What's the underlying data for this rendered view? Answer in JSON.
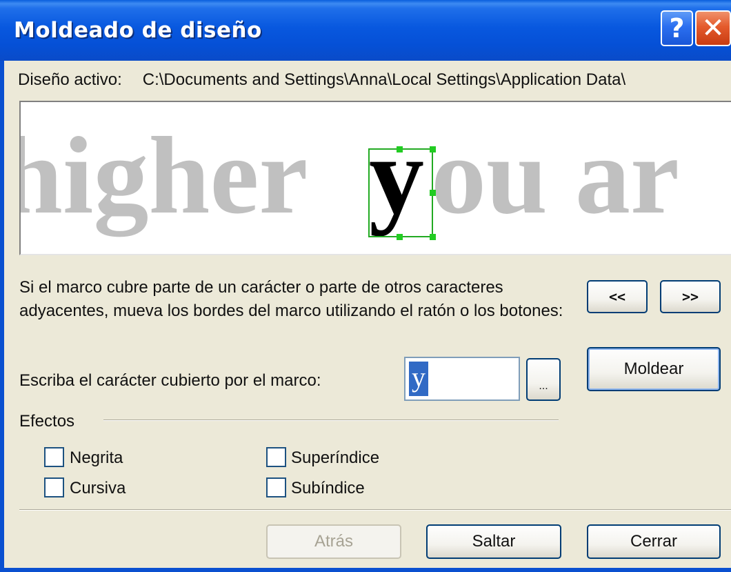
{
  "window": {
    "title": "Moldeado de diseño",
    "help_label": "?",
    "close_label": "✕"
  },
  "active_pattern": {
    "label": "Diseño activo:",
    "path": "C:\\Documents and Settings\\Anna\\Local Settings\\Application Data\\"
  },
  "preview": {
    "text": "higher you ar",
    "highlighted_char": "y",
    "frame_color": "#22aa22"
  },
  "instructions": "Si el marco cubre parte de un carácter o parte de otros caracteres adyacentes, mueva los bordes del marco utilizando el ratón o los botones:",
  "nav": {
    "prev_label": "<<",
    "next_label": ">>"
  },
  "mold_button": "Moldear",
  "char_prompt": {
    "label": "Escriba el carácter cubierto por el marco:",
    "value": "y",
    "browse_label": "..."
  },
  "effects": {
    "label": "Efectos",
    "bold": "Negrita",
    "italic": "Cursiva",
    "superscript": "Superíndice",
    "subscript": "Subíndice"
  },
  "footer": {
    "back": "Atrás",
    "skip": "Saltar",
    "close": "Cerrar"
  },
  "colors": {
    "title_bar": "#0550d6",
    "selection": "#316ac5",
    "preview_text": "#c0c0c0"
  }
}
